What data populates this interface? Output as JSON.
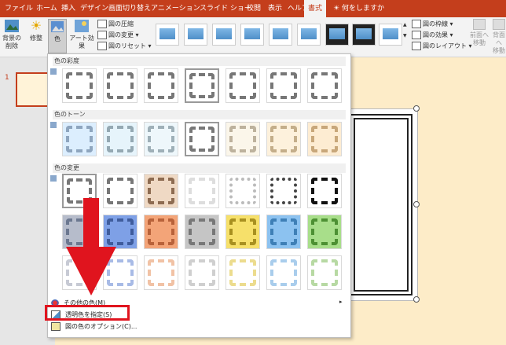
{
  "tabs": [
    "ファイル",
    "ホーム",
    "挿入",
    "デザイン",
    "画面切り替え",
    "アニメーション",
    "スライド ショー",
    "校閲",
    "表示",
    "ヘルプ",
    "書式",
    "何をしますか"
  ],
  "ribbon": {
    "remove_bg": "背景の\n削除",
    "corrections": "修整",
    "color": "色",
    "artistic": "アート効果",
    "compress": "図の圧縮",
    "change": "図の変更",
    "reset": "図のリセット",
    "border": "図の枠線",
    "effects": "図の効果",
    "layout": "図のレイアウト",
    "bring_forward": "前面へ\n移動",
    "send_backward": "背面へ\n移動"
  },
  "slide_pane": {
    "number": "1"
  },
  "menu": {
    "section_saturation": "色の彩度",
    "section_tone": "色のトーン",
    "section_recolor": "色の変更",
    "more_colors": "その他の色(M)",
    "set_transparent": "透明色を指定(S)",
    "options": "図の色のオプション(C)..."
  },
  "recolor_colors": [
    "#b6bccb",
    "#7ea0e6",
    "#f3a478",
    "#c5c5c5",
    "#f6e06a",
    "#8cc2f0",
    "#a8de8a"
  ],
  "accent": "#c43e1c",
  "highlight_color": "#e0141e"
}
